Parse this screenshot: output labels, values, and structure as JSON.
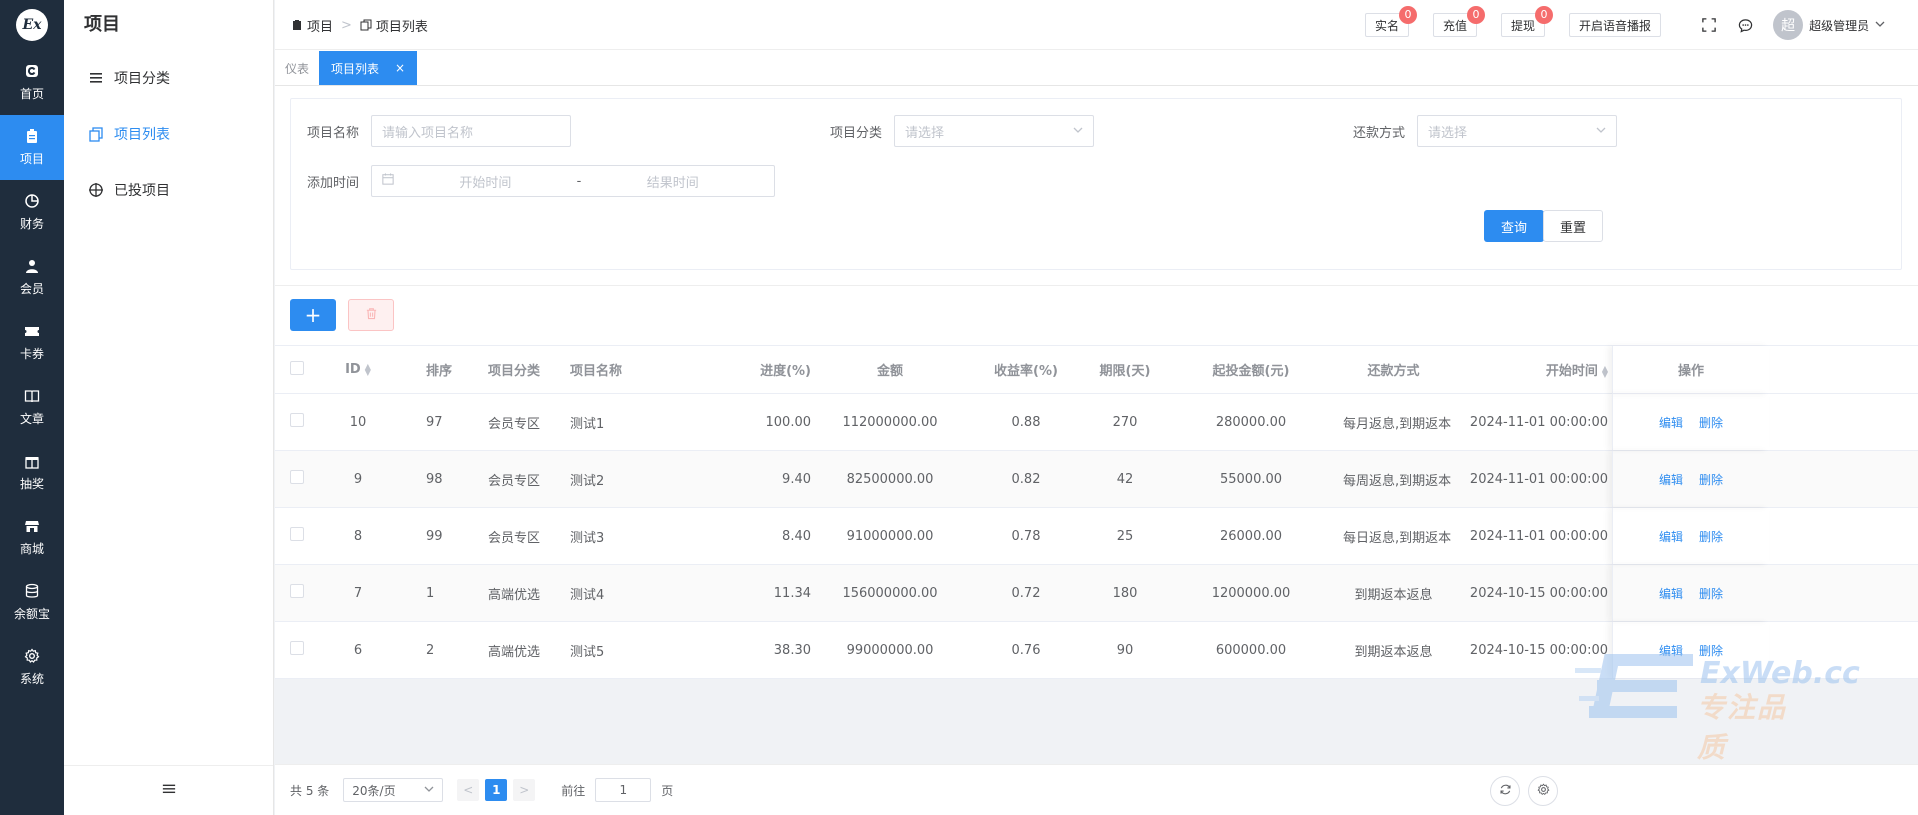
{
  "rail": {
    "logo": "Ex",
    "items": [
      {
        "label": "首页",
        "icon": "home-icon"
      },
      {
        "label": "项目",
        "icon": "clipboard-icon",
        "active": true
      },
      {
        "label": "财务",
        "icon": "pie-chart-icon"
      },
      {
        "label": "会员",
        "icon": "user-icon"
      },
      {
        "label": "卡券",
        "icon": "ticket-icon"
      },
      {
        "label": "文章",
        "icon": "book-icon"
      },
      {
        "label": "抽奖",
        "icon": "gift-icon"
      },
      {
        "label": "商城",
        "icon": "shop-icon"
      },
      {
        "label": "余额宝",
        "icon": "database-icon"
      },
      {
        "label": "系统",
        "icon": "gear-icon"
      }
    ]
  },
  "submenu": {
    "title": "项目",
    "items": [
      {
        "label": "项目分类",
        "icon": "list-icon"
      },
      {
        "label": "项目列表",
        "icon": "copy-icon",
        "active": true
      },
      {
        "label": "已投项目",
        "icon": "target-icon"
      }
    ]
  },
  "header": {
    "breadcrumb": [
      "项目",
      "项目列表"
    ],
    "buttons": [
      {
        "label": "实名",
        "badge": "0"
      },
      {
        "label": "充值",
        "badge": "0"
      },
      {
        "label": "提现",
        "badge": "0"
      },
      {
        "label": "开启语音播报",
        "badge": ""
      }
    ],
    "user": {
      "avatar": "超",
      "name": "超级管理员"
    }
  },
  "tabs": [
    {
      "label": "仪表"
    },
    {
      "label": "项目列表",
      "active": true,
      "close": "×"
    }
  ],
  "search": {
    "name_label": "项目名称",
    "name_placeholder": "请输入项目名称",
    "category_label": "项目分类",
    "category_placeholder": "请选择",
    "repay_label": "还款方式",
    "repay_placeholder": "请选择",
    "time_label": "添加时间",
    "time_start": "开始时间",
    "time_sep": "-",
    "time_end": "结果时间",
    "query_label": "查询",
    "reset_label": "重置"
  },
  "toolbar": {
    "add_label": "+"
  },
  "table": {
    "headers": {
      "id": "ID",
      "sort": "排序",
      "category": "项目分类",
      "name": "项目名称",
      "progress": "进度(%)",
      "amount": "金额",
      "rate": "收益率(%)",
      "term": "期限(天)",
      "min": "起投金额(元)",
      "repay": "还款方式",
      "start": "开始时间",
      "ops": "操作"
    },
    "edit_label": "编辑",
    "delete_label": "删除",
    "rows": [
      {
        "id": "10",
        "sort": "97",
        "category": "会员专区",
        "name": "测试1",
        "progress": "100.00",
        "amount": "112000000.00",
        "rate": "0.88",
        "term": "270",
        "min": "280000.00",
        "repay": "每月返息,到期返本",
        "start": "2024-11-01 00:00:00"
      },
      {
        "id": "9",
        "sort": "98",
        "category": "会员专区",
        "name": "测试2",
        "progress": "9.40",
        "amount": "82500000.00",
        "rate": "0.82",
        "term": "42",
        "min": "55000.00",
        "repay": "每周返息,到期返本",
        "start": "2024-11-01 00:00:00"
      },
      {
        "id": "8",
        "sort": "99",
        "category": "会员专区",
        "name": "测试3",
        "progress": "8.40",
        "amount": "91000000.00",
        "rate": "0.78",
        "term": "25",
        "min": "26000.00",
        "repay": "每日返息,到期返本",
        "start": "2024-11-01 00:00:00"
      },
      {
        "id": "7",
        "sort": "1",
        "category": "高端优选",
        "name": "测试4",
        "progress": "11.34",
        "amount": "156000000.00",
        "rate": "0.72",
        "term": "180",
        "min": "1200000.00",
        "repay": "到期返本返息",
        "start": "2024-10-15 00:00:00"
      },
      {
        "id": "6",
        "sort": "2",
        "category": "高端优选",
        "name": "测试5",
        "progress": "38.30",
        "amount": "99000000.00",
        "rate": "0.76",
        "term": "90",
        "min": "600000.00",
        "repay": "到期返本返息",
        "start": "2024-10-15 00:00:00"
      }
    ]
  },
  "pager": {
    "total": "共 5 条",
    "size": "20条/页",
    "prev": "<",
    "current": "1",
    "next": ">",
    "goto_prefix": "前往",
    "goto_value": "1",
    "goto_suffix": "页"
  },
  "watermark": {
    "line1": "ExWeb.cc",
    "line2": "专注品质"
  },
  "colors": {
    "primary": "#2d8cf0",
    "rail": "#1f2d3d",
    "badge": "#f56c6c"
  }
}
